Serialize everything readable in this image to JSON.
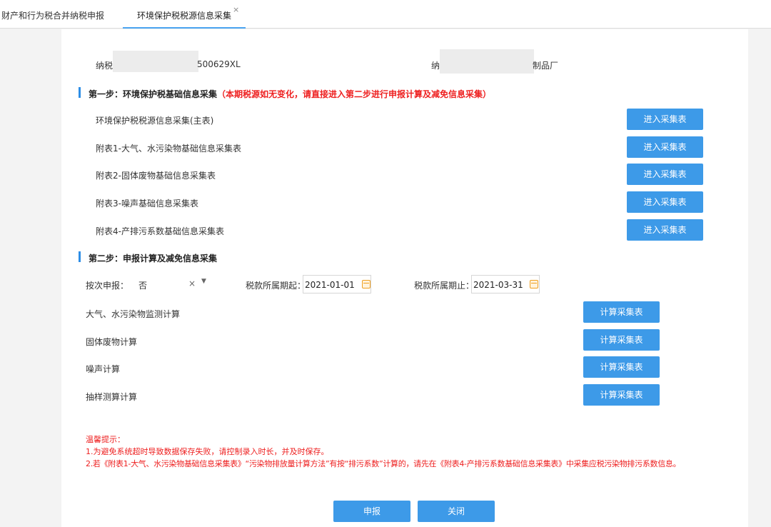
{
  "tabs": [
    {
      "label": "财产和行为税合并纳税申报",
      "active": false
    },
    {
      "label": "环境保护税税源信息采集",
      "active": true,
      "close": "×"
    }
  ],
  "taxpayer": {
    "id_label": "纳税",
    "id_value_tail": "500629XL",
    "name_label": "纳",
    "name_value_tail": "制品厂"
  },
  "step1": {
    "title": "第一步：环境保护税基础信息采集",
    "note": "（本期税源如无变化，请直接进入第二步进行申报计算及减免信息采集）",
    "rows": [
      {
        "label": "环境保护税税源信息采集(主表)",
        "button": "进入采集表"
      },
      {
        "label": "附表1-大气、水污染物基础信息采集表",
        "button": "进入采集表"
      },
      {
        "label": "附表2-固体废物基础信息采集表",
        "button": "进入采集表"
      },
      {
        "label": "附表3-噪声基础信息采集表",
        "button": "进入采集表"
      },
      {
        "label": "附表4-产排污系数基础信息采集表",
        "button": "进入采集表"
      }
    ]
  },
  "step2": {
    "title": "第二步：申报计算及减免信息采集",
    "by_time": {
      "label": "按次申报：",
      "value": "否",
      "clear": "×",
      "arrow": "▼"
    },
    "period_start": {
      "label": "税款所属期起：",
      "value": "2021-01-01"
    },
    "period_end": {
      "label": "税款所属期止：",
      "value": "2021-03-31"
    },
    "rows": [
      {
        "label": "大气、水污染物监测计算",
        "button": "计算采集表"
      },
      {
        "label": "固体废物计算",
        "button": "计算采集表"
      },
      {
        "label": "噪声计算",
        "button": "计算采集表"
      },
      {
        "label": "抽样测算计算",
        "button": "计算采集表"
      }
    ]
  },
  "tips": {
    "title": "温馨提示：",
    "line1": "1.为避免系统超时导致数据保存失败，请控制录入时长，并及时保存。",
    "line2": "2.若《附表1-大气、水污染物基础信息采集表》“污染物排放量计算方法”有按“排污系数”计算的，请先在《附表4-产排污系数基础信息采集表》中采集应税污染物排污系数信息。"
  },
  "footer": {
    "submit": "申报",
    "close": "关闭"
  },
  "colors": {
    "accent": "#3d9ae8",
    "warning": "#ee2020",
    "icon": "#f0a020"
  }
}
